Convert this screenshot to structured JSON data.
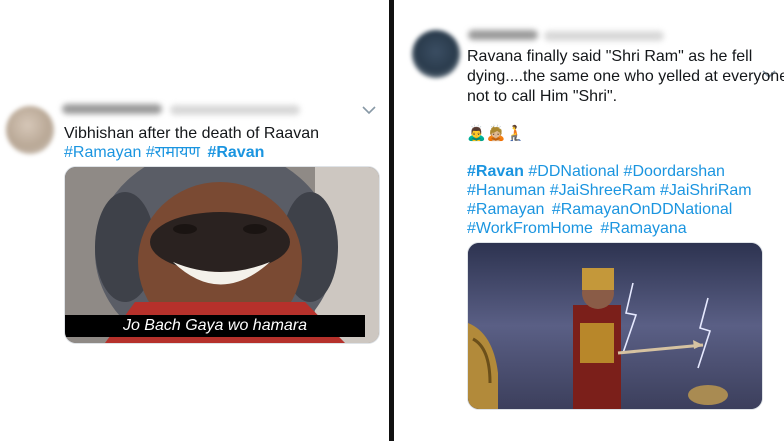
{
  "tweet_left": {
    "text": "Vibhishan after the death of Raavan",
    "hashtags": [
      "#Ramayan",
      "#रामायण",
      "#Ravan"
    ],
    "image_caption": "Jo Bach Gaya wo hamara"
  },
  "tweet_right": {
    "text_lines": [
      "Ravana finally said \"Shri Ram\" as he fell",
      "dying....the same one who yelled at everyone",
      "not to call Him \"Shri\"."
    ],
    "emojis": "🙇‍♂️🙇🏼🧎",
    "hashtag_lines": [
      [
        "#Ravan",
        "#DDNational",
        "#Doordarshan"
      ],
      [
        "#Hanuman",
        "#JaiShreeRam",
        "#JaiShriRam"
      ],
      [
        "#Ramayan",
        "#RamayanOnDDNational"
      ],
      [
        "#WorkFromHome",
        "#Ramayana"
      ]
    ]
  },
  "colors": {
    "hashtag": "#1b95e0",
    "divider": "#111111"
  },
  "icons": [
    "chevron-down-icon",
    "emoji-bow-icon"
  ]
}
